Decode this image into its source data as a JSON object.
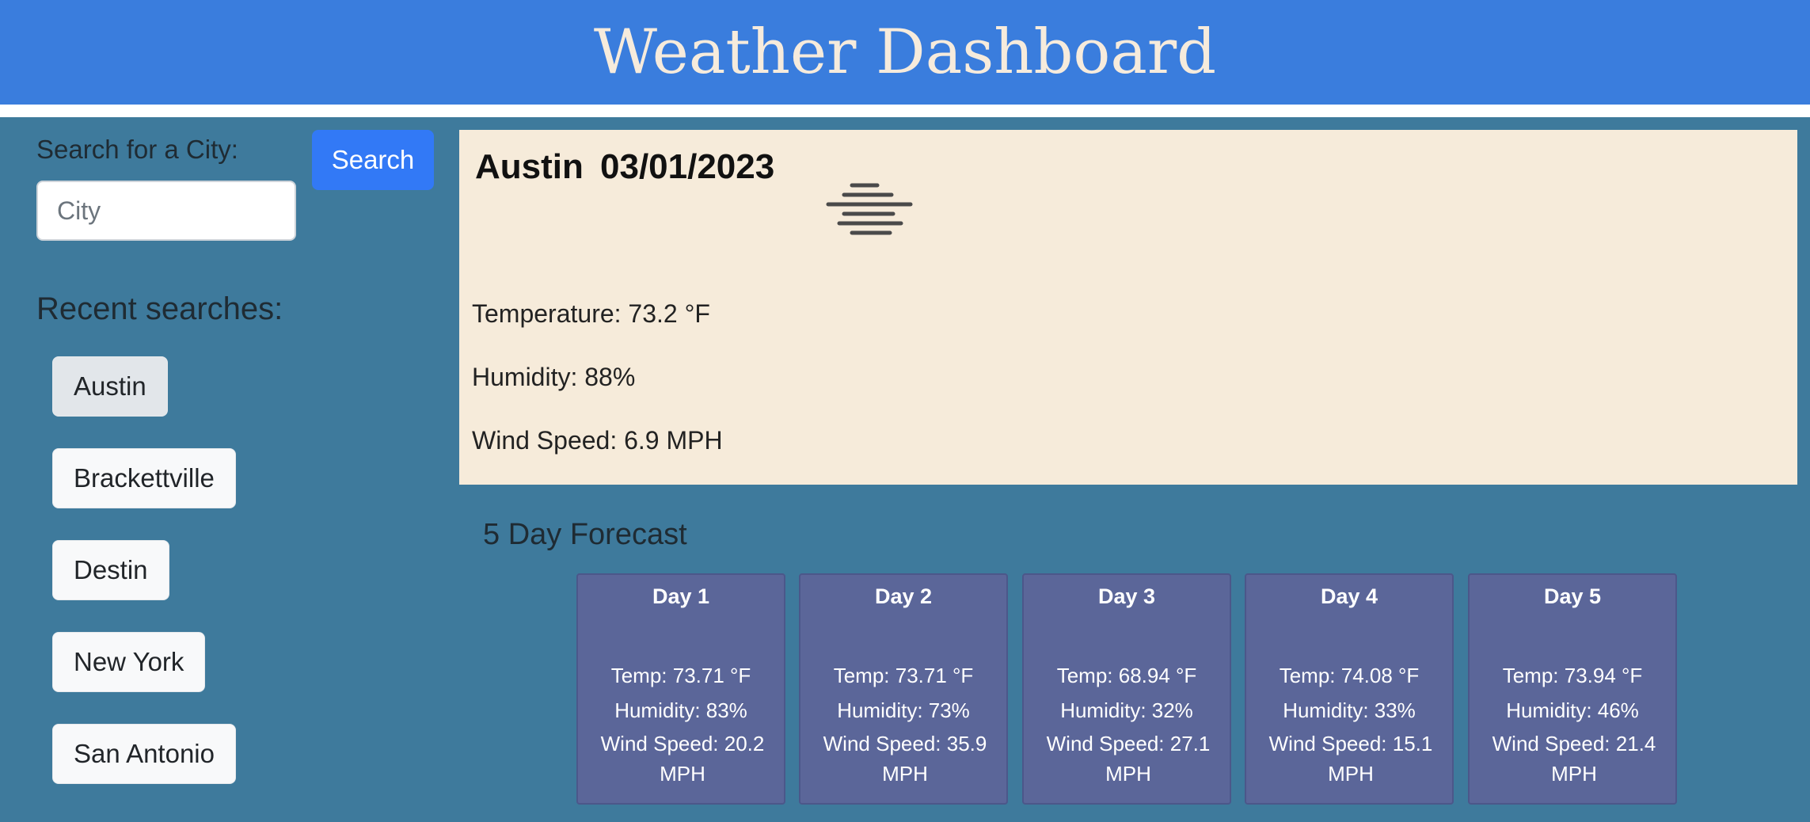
{
  "header": {
    "title": "Weather Dashboard"
  },
  "search": {
    "label": "Search for a City:",
    "placeholder": "City",
    "value": "",
    "button_label": "Search"
  },
  "recent": {
    "heading": "Recent searches:",
    "items": [
      {
        "label": "Austin"
      },
      {
        "label": "Brackettville"
      },
      {
        "label": "Destin"
      },
      {
        "label": "New York"
      },
      {
        "label": "San Antonio"
      }
    ]
  },
  "current": {
    "city": "Austin",
    "date": "03/01/2023",
    "icon": "mist-icon",
    "temperature": "Temperature: 73.2 °F",
    "humidity": "Humidity: 88%",
    "wind": "Wind Speed: 6.9 MPH"
  },
  "forecast": {
    "title": "5 Day Forecast",
    "days": [
      {
        "day": "Day 1",
        "temp": "Temp: 73.71 °F",
        "humidity": "Humidity: 83%",
        "wind": "Wind Speed: 20.2 MPH"
      },
      {
        "day": "Day 2",
        "temp": "Temp: 73.71 °F",
        "humidity": "Humidity: 73%",
        "wind": "Wind Speed: 35.9 MPH"
      },
      {
        "day": "Day 3",
        "temp": "Temp: 68.94 °F",
        "humidity": "Humidity: 32%",
        "wind": "Wind Speed: 27.1 MPH"
      },
      {
        "day": "Day 4",
        "temp": "Temp: 74.08 °F",
        "humidity": "Humidity: 33%",
        "wind": "Wind Speed: 15.1 MPH"
      },
      {
        "day": "Day 5",
        "temp": "Temp: 73.94 °F",
        "humidity": "Humidity: 46%",
        "wind": "Wind Speed: 21.4 MPH"
      }
    ]
  },
  "colors": {
    "header": "#3a7ddd",
    "page_background": "#3e7a9c",
    "current_card": "#f6ebda",
    "forecast_card": "#5b6699",
    "search_button": "#3279f6"
  }
}
